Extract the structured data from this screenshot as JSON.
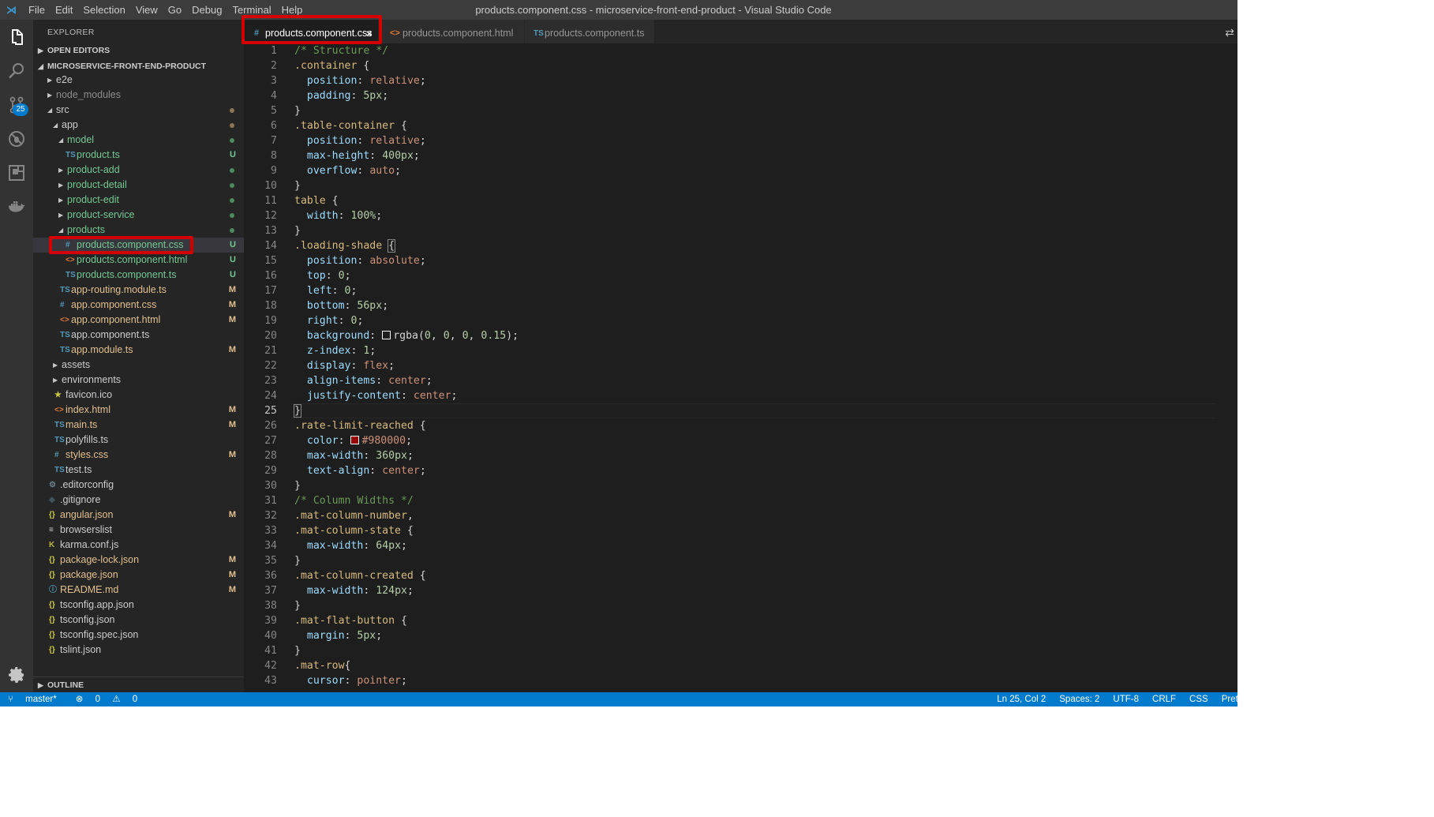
{
  "window": {
    "title": "products.component.css - microservice-front-end-product - Visual Studio Code",
    "menu": [
      "File",
      "Edit",
      "Selection",
      "View",
      "Go",
      "Debug",
      "Terminal",
      "Help"
    ]
  },
  "activity_bar": {
    "items": [
      {
        "name": "files-icon"
      },
      {
        "name": "search-icon"
      },
      {
        "name": "source-control-icon",
        "badge": "25"
      },
      {
        "name": "debug-icon"
      },
      {
        "name": "extensions-icon"
      },
      {
        "name": "docker-icon"
      }
    ],
    "settings_icon": "gear-icon"
  },
  "sidebar": {
    "header": "EXPLORER",
    "sections": {
      "open_editors": "OPEN EDITORS",
      "project": "MICROSERVICE-FRONT-END-PRODUCT",
      "outline": "OUTLINE"
    },
    "tree": [
      {
        "name": "e2e",
        "type": "folder",
        "depth": 0,
        "state": "collapsed",
        "color": "#cccccc"
      },
      {
        "name": "node_modules",
        "type": "folder",
        "depth": 0,
        "state": "collapsed",
        "color": "#8c8c8c"
      },
      {
        "name": "src",
        "type": "folder",
        "depth": 0,
        "state": "expanded",
        "color": "#cccccc",
        "dot": "#8c7554"
      },
      {
        "name": "app",
        "type": "folder",
        "depth": 1,
        "state": "expanded",
        "color": "#cccccc",
        "dot": "#8c7554"
      },
      {
        "name": "model",
        "type": "folder",
        "depth": 2,
        "state": "expanded",
        "color": "#73c991",
        "dot": "#4d8a5f"
      },
      {
        "name": "product.ts",
        "type": "file",
        "icon": "TS",
        "depth": 3,
        "color": "#73c991",
        "status": "U"
      },
      {
        "name": "product-add",
        "type": "folder",
        "depth": 2,
        "state": "collapsed",
        "color": "#73c991",
        "dot": "#4d8a5f"
      },
      {
        "name": "product-detail",
        "type": "folder",
        "depth": 2,
        "state": "collapsed",
        "color": "#73c991",
        "dot": "#4d8a5f"
      },
      {
        "name": "product-edit",
        "type": "folder",
        "depth": 2,
        "state": "collapsed",
        "color": "#73c991",
        "dot": "#4d8a5f"
      },
      {
        "name": "product-service",
        "type": "folder",
        "depth": 2,
        "state": "collapsed",
        "color": "#73c991",
        "dot": "#4d8a5f"
      },
      {
        "name": "products",
        "type": "folder",
        "depth": 2,
        "state": "expanded",
        "color": "#73c991",
        "dot": "#4d8a5f"
      },
      {
        "name": "products.component.css",
        "type": "file",
        "icon": "#",
        "depth": 3,
        "color": "#73c991",
        "status": "U",
        "selected": true
      },
      {
        "name": "products.component.html",
        "type": "file",
        "icon": "<>",
        "depth": 3,
        "color": "#73c991",
        "status": "U"
      },
      {
        "name": "products.component.ts",
        "type": "file",
        "icon": "TS",
        "depth": 3,
        "color": "#73c991",
        "status": "U"
      },
      {
        "name": "app-routing.module.ts",
        "type": "file",
        "icon": "TS",
        "depth": 2,
        "color": "#e2c08d",
        "status": "M"
      },
      {
        "name": "app.component.css",
        "type": "file",
        "icon": "#",
        "depth": 2,
        "color": "#e2c08d",
        "status": "M"
      },
      {
        "name": "app.component.html",
        "type": "file",
        "icon": "<>",
        "depth": 2,
        "color": "#e2c08d",
        "status": "M"
      },
      {
        "name": "app.component.ts",
        "type": "file",
        "icon": "TS",
        "depth": 2,
        "color": "#cccccc"
      },
      {
        "name": "app.module.ts",
        "type": "file",
        "icon": "TS",
        "depth": 2,
        "color": "#e2c08d",
        "status": "M"
      },
      {
        "name": "assets",
        "type": "folder",
        "depth": 1,
        "state": "collapsed",
        "color": "#cccccc"
      },
      {
        "name": "environments",
        "type": "folder",
        "depth": 1,
        "state": "collapsed",
        "color": "#cccccc"
      },
      {
        "name": "favicon.ico",
        "type": "file",
        "icon": "★",
        "depth": 1,
        "color": "#cccccc"
      },
      {
        "name": "index.html",
        "type": "file",
        "icon": "<>",
        "depth": 1,
        "color": "#e2c08d",
        "status": "M"
      },
      {
        "name": "main.ts",
        "type": "file",
        "icon": "TS",
        "depth": 1,
        "color": "#e2c08d",
        "status": "M"
      },
      {
        "name": "polyfills.ts",
        "type": "file",
        "icon": "TS",
        "depth": 1,
        "color": "#cccccc"
      },
      {
        "name": "styles.css",
        "type": "file",
        "icon": "#",
        "depth": 1,
        "color": "#e2c08d",
        "status": "M"
      },
      {
        "name": "test.ts",
        "type": "file",
        "icon": "TS",
        "depth": 1,
        "color": "#cccccc"
      },
      {
        "name": ".editorconfig",
        "type": "file",
        "icon": "⚙",
        "depth": 0,
        "color": "#cccccc"
      },
      {
        "name": ".gitignore",
        "type": "file",
        "icon": "◆",
        "depth": 0,
        "color": "#cccccc"
      },
      {
        "name": "angular.json",
        "type": "file",
        "icon": "{}",
        "depth": 0,
        "color": "#e2c08d",
        "status": "M"
      },
      {
        "name": "browserslist",
        "type": "file",
        "icon": "≡",
        "depth": 0,
        "color": "#cccccc"
      },
      {
        "name": "karma.conf.js",
        "type": "file",
        "icon": "K",
        "depth": 0,
        "color": "#cccccc"
      },
      {
        "name": "package-lock.json",
        "type": "file",
        "icon": "{}",
        "depth": 0,
        "color": "#e2c08d",
        "status": "M"
      },
      {
        "name": "package.json",
        "type": "file",
        "icon": "{}",
        "depth": 0,
        "color": "#e2c08d",
        "status": "M"
      },
      {
        "name": "README.md",
        "type": "file",
        "icon": "ⓘ",
        "depth": 0,
        "color": "#e2c08d",
        "status": "M"
      },
      {
        "name": "tsconfig.app.json",
        "type": "file",
        "icon": "{}",
        "depth": 0,
        "color": "#cccccc"
      },
      {
        "name": "tsconfig.json",
        "type": "file",
        "icon": "{}",
        "depth": 0,
        "color": "#cccccc"
      },
      {
        "name": "tsconfig.spec.json",
        "type": "file",
        "icon": "{}",
        "depth": 0,
        "color": "#cccccc"
      },
      {
        "name": "tslint.json",
        "type": "file",
        "icon": "{}",
        "depth": 0,
        "color": "#cccccc"
      }
    ]
  },
  "tabs": [
    {
      "label": "products.component.css",
      "icon": "#",
      "active": true,
      "close": "×"
    },
    {
      "label": "products.component.html",
      "icon": "<>",
      "active": false
    },
    {
      "label": "products.component.ts",
      "icon": "TS",
      "active": false
    }
  ],
  "editor": {
    "current_line": 25,
    "lines": [
      [
        [
          "cm",
          "/* Structure */"
        ]
      ],
      [
        [
          "sel",
          ".container"
        ],
        [
          "pun",
          " {"
        ]
      ],
      [
        [
          "pun",
          "  "
        ],
        [
          "prop",
          "position"
        ],
        [
          "pun",
          ": "
        ],
        [
          "val",
          "relative"
        ],
        [
          "pun",
          ";"
        ]
      ],
      [
        [
          "pun",
          "  "
        ],
        [
          "prop",
          "padding"
        ],
        [
          "pun",
          ": "
        ],
        [
          "num",
          "5px"
        ],
        [
          "pun",
          ";"
        ]
      ],
      [
        [
          "pun",
          "}"
        ]
      ],
      [
        [
          "sel",
          ".table-container"
        ],
        [
          "pun",
          " {"
        ]
      ],
      [
        [
          "pun",
          "  "
        ],
        [
          "prop",
          "position"
        ],
        [
          "pun",
          ": "
        ],
        [
          "val",
          "relative"
        ],
        [
          "pun",
          ";"
        ]
      ],
      [
        [
          "pun",
          "  "
        ],
        [
          "prop",
          "max-height"
        ],
        [
          "pun",
          ": "
        ],
        [
          "num",
          "400px"
        ],
        [
          "pun",
          ";"
        ]
      ],
      [
        [
          "pun",
          "  "
        ],
        [
          "prop",
          "overflow"
        ],
        [
          "pun",
          ": "
        ],
        [
          "val",
          "auto"
        ],
        [
          "pun",
          ";"
        ]
      ],
      [
        [
          "pun",
          "}"
        ]
      ],
      [
        [
          "sel",
          "table"
        ],
        [
          "pun",
          " {"
        ]
      ],
      [
        [
          "pun",
          "  "
        ],
        [
          "prop",
          "width"
        ],
        [
          "pun",
          ": "
        ],
        [
          "num",
          "100%"
        ],
        [
          "pun",
          ";"
        ]
      ],
      [
        [
          "pun",
          "}"
        ]
      ],
      [
        [
          "sel",
          ".loading-shade"
        ],
        [
          "pun",
          " "
        ],
        [
          "brk",
          "{"
        ]
      ],
      [
        [
          "pun",
          "  "
        ],
        [
          "prop",
          "position"
        ],
        [
          "pun",
          ": "
        ],
        [
          "val",
          "absolute"
        ],
        [
          "pun",
          ";"
        ]
      ],
      [
        [
          "pun",
          "  "
        ],
        [
          "prop",
          "top"
        ],
        [
          "pun",
          ": "
        ],
        [
          "num",
          "0"
        ],
        [
          "pun",
          ";"
        ]
      ],
      [
        [
          "pun",
          "  "
        ],
        [
          "prop",
          "left"
        ],
        [
          "pun",
          ": "
        ],
        [
          "num",
          "0"
        ],
        [
          "pun",
          ";"
        ]
      ],
      [
        [
          "pun",
          "  "
        ],
        [
          "prop",
          "bottom"
        ],
        [
          "pun",
          ": "
        ],
        [
          "num",
          "56px"
        ],
        [
          "pun",
          ";"
        ]
      ],
      [
        [
          "pun",
          "  "
        ],
        [
          "prop",
          "right"
        ],
        [
          "pun",
          ": "
        ],
        [
          "num",
          "0"
        ],
        [
          "pun",
          ";"
        ]
      ],
      [
        [
          "pun",
          "  "
        ],
        [
          "prop",
          "background"
        ],
        [
          "pun",
          ": "
        ],
        [
          "sw",
          "rgba(0,0,0,0.15)"
        ],
        [
          "fn",
          "rgba("
        ],
        [
          "num",
          "0"
        ],
        [
          "pun",
          ", "
        ],
        [
          "num",
          "0"
        ],
        [
          "pun",
          ", "
        ],
        [
          "num",
          "0"
        ],
        [
          "pun",
          ", "
        ],
        [
          "num",
          "0.15"
        ],
        [
          "fn",
          ")"
        ],
        [
          "pun",
          ";"
        ]
      ],
      [
        [
          "pun",
          "  "
        ],
        [
          "prop",
          "z-index"
        ],
        [
          "pun",
          ": "
        ],
        [
          "num",
          "1"
        ],
        [
          "pun",
          ";"
        ]
      ],
      [
        [
          "pun",
          "  "
        ],
        [
          "prop",
          "display"
        ],
        [
          "pun",
          ": "
        ],
        [
          "val",
          "flex"
        ],
        [
          "pun",
          ";"
        ]
      ],
      [
        [
          "pun",
          "  "
        ],
        [
          "prop",
          "align-items"
        ],
        [
          "pun",
          ": "
        ],
        [
          "val",
          "center"
        ],
        [
          "pun",
          ";"
        ]
      ],
      [
        [
          "pun",
          "  "
        ],
        [
          "prop",
          "justify-content"
        ],
        [
          "pun",
          ": "
        ],
        [
          "val",
          "center"
        ],
        [
          "pun",
          ";"
        ]
      ],
      [
        [
          "brk",
          "}"
        ]
      ],
      [
        [
          "sel",
          ".rate-limit-reached"
        ],
        [
          "pun",
          " {"
        ]
      ],
      [
        [
          "pun",
          "  "
        ],
        [
          "prop",
          "color"
        ],
        [
          "pun",
          ": "
        ],
        [
          "sw",
          "#980000"
        ],
        [
          "val",
          "#980000"
        ],
        [
          "pun",
          ";"
        ]
      ],
      [
        [
          "pun",
          "  "
        ],
        [
          "prop",
          "max-width"
        ],
        [
          "pun",
          ": "
        ],
        [
          "num",
          "360px"
        ],
        [
          "pun",
          ";"
        ]
      ],
      [
        [
          "pun",
          "  "
        ],
        [
          "prop",
          "text-align"
        ],
        [
          "pun",
          ": "
        ],
        [
          "val",
          "center"
        ],
        [
          "pun",
          ";"
        ]
      ],
      [
        [
          "pun",
          "}"
        ]
      ],
      [
        [
          "cm",
          "/* Column Widths */"
        ]
      ],
      [
        [
          "sel",
          ".mat-column-number"
        ],
        [
          "pun",
          ","
        ]
      ],
      [
        [
          "sel",
          ".mat-column-state"
        ],
        [
          "pun",
          " {"
        ]
      ],
      [
        [
          "pun",
          "  "
        ],
        [
          "prop",
          "max-width"
        ],
        [
          "pun",
          ": "
        ],
        [
          "num",
          "64px"
        ],
        [
          "pun",
          ";"
        ]
      ],
      [
        [
          "pun",
          "}"
        ]
      ],
      [
        [
          "sel",
          ".mat-column-created"
        ],
        [
          "pun",
          " {"
        ]
      ],
      [
        [
          "pun",
          "  "
        ],
        [
          "prop",
          "max-width"
        ],
        [
          "pun",
          ": "
        ],
        [
          "num",
          "124px"
        ],
        [
          "pun",
          ";"
        ]
      ],
      [
        [
          "pun",
          "}"
        ]
      ],
      [
        [
          "sel",
          ".mat-flat-button"
        ],
        [
          "pun",
          " {"
        ]
      ],
      [
        [
          "pun",
          "  "
        ],
        [
          "prop",
          "margin"
        ],
        [
          "pun",
          ": "
        ],
        [
          "num",
          "5px"
        ],
        [
          "pun",
          ";"
        ]
      ],
      [
        [
          "pun",
          "}"
        ]
      ],
      [
        [
          "sel",
          ".mat-row"
        ],
        [
          "pun",
          "{"
        ]
      ],
      [
        [
          "pun",
          "  "
        ],
        [
          "prop",
          "cursor"
        ],
        [
          "pun",
          ": "
        ],
        [
          "val",
          "pointer"
        ],
        [
          "pun",
          ";"
        ]
      ]
    ]
  },
  "statusbar": {
    "branch": "master*",
    "errors": "0",
    "warnings": "0",
    "position": "Ln 25, Col 2",
    "spaces": "Spaces: 2",
    "encoding": "UTF-8",
    "eol": "CRLF",
    "language": "CSS",
    "formatter": "Prett"
  },
  "colors": {
    "accent": "#007acc",
    "highlight_box": "#d40000",
    "untracked": "#73c991",
    "modified": "#e2c08d"
  }
}
